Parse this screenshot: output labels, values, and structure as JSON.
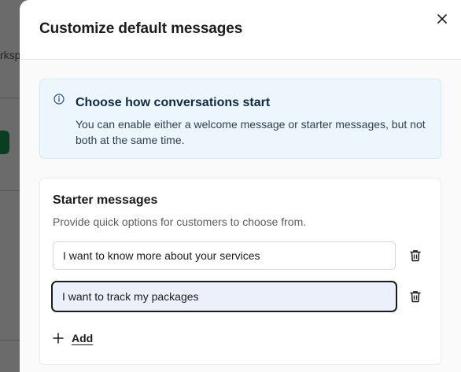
{
  "background": {
    "fragment_text": "rksp"
  },
  "dialog": {
    "title": "Customize default messages",
    "close_icon": "close-icon"
  },
  "info": {
    "icon": "info-icon",
    "title": "Choose how conversations start",
    "description": "You can enable either a welcome message or starter messages, but not both at the same time."
  },
  "starter": {
    "title": "Starter messages",
    "description": "Provide quick options for customers to choose from.",
    "messages": [
      {
        "value": "I want to know more about your services",
        "focused": false
      },
      {
        "value": "I want to track my packages",
        "focused": true
      }
    ],
    "add_label": "Add"
  },
  "colors": {
    "info_bg": "#eef6fd",
    "focused_input_bg": "#ebf0fb",
    "text_primary": "#1b1b1b"
  }
}
